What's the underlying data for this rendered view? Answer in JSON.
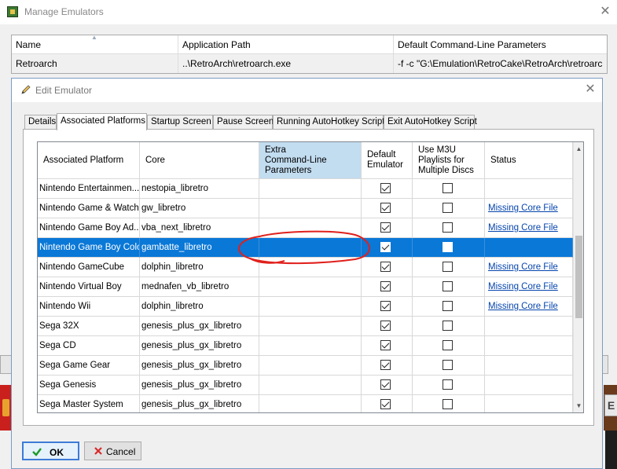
{
  "outer_window": {
    "title": "Manage Emulators",
    "columns": [
      "Name",
      "Application Path",
      "Default Command-Line Parameters"
    ],
    "row": {
      "name": "Retroarch",
      "path": "..\\RetroArch\\retroarch.exe",
      "params": "-f -c \"G:\\Emulation\\RetroCake\\RetroArch\\retroarc"
    }
  },
  "dialog": {
    "title": "Edit Emulator",
    "tabs": [
      "Details",
      "Associated Platforms",
      "Startup Screen",
      "Pause Screen",
      "Running AutoHotkey Script",
      "Exit AutoHotkey Script"
    ],
    "active_tab": "Associated Platforms",
    "columns": {
      "platform": "Associated Platform",
      "core": "Core",
      "extra_1": "Extra",
      "extra_2": "Command-Line",
      "extra_3": "Parameters",
      "default_1": "Default",
      "default_2": "Emulator",
      "m3u_1": "Use M3U",
      "m3u_2": "Playlists for",
      "m3u_3": "Multiple Discs",
      "status": "Status"
    },
    "rows": [
      {
        "platform": "Nintendo Entertainmen...",
        "core": "nestopia_libretro",
        "extra": "",
        "default": true,
        "m3u": false,
        "status": ""
      },
      {
        "platform": "Nintendo Game & Watch",
        "core": "gw_libretro",
        "extra": "",
        "default": true,
        "m3u": false,
        "status": "Missing Core File"
      },
      {
        "platform": "Nintendo Game Boy Ad...",
        "core": "vba_next_libretro",
        "extra": "",
        "default": true,
        "m3u": false,
        "status": "Missing Core File"
      },
      {
        "platform": "Nintendo Game Boy Color",
        "core": "gambatte_libretro",
        "extra": "",
        "default": true,
        "m3u": false,
        "status": "",
        "selected": true
      },
      {
        "platform": "Nintendo GameCube",
        "core": "dolphin_libretro",
        "extra": "",
        "default": true,
        "m3u": false,
        "status": "Missing Core File"
      },
      {
        "platform": "Nintendo Virtual Boy",
        "core": "mednafen_vb_libretro",
        "extra": "",
        "default": true,
        "m3u": false,
        "status": "Missing Core File"
      },
      {
        "platform": "Nintendo Wii",
        "core": "dolphin_libretro",
        "extra": "",
        "default": true,
        "m3u": false,
        "status": "Missing Core File"
      },
      {
        "platform": "Sega 32X",
        "core": "genesis_plus_gx_libretro",
        "extra": "",
        "default": true,
        "m3u": false,
        "status": ""
      },
      {
        "platform": "Sega CD",
        "core": "genesis_plus_gx_libretro",
        "extra": "",
        "default": true,
        "m3u": false,
        "status": ""
      },
      {
        "platform": "Sega Game Gear",
        "core": "genesis_plus_gx_libretro",
        "extra": "",
        "default": true,
        "m3u": false,
        "status": ""
      },
      {
        "platform": "Sega Genesis",
        "core": "genesis_plus_gx_libretro",
        "extra": "",
        "default": true,
        "m3u": false,
        "status": ""
      },
      {
        "platform": "Sega Master System",
        "core": "genesis_plus_gx_libretro",
        "extra": "",
        "default": true,
        "m3u": false,
        "status": ""
      }
    ],
    "buttons": {
      "ok": "OK",
      "cancel": "Cancel"
    }
  },
  "colors": {
    "selection": "#0a78d7",
    "header_selected": "#c2dcf0",
    "link": "#0645ad",
    "annotation": "#e0201c"
  },
  "icons": [
    "app-icon",
    "close-icon",
    "pencil-icon",
    "checkmark-icon",
    "x-icon",
    "scroll-up-icon",
    "scroll-down-icon",
    "sort-arrow-icon"
  ]
}
